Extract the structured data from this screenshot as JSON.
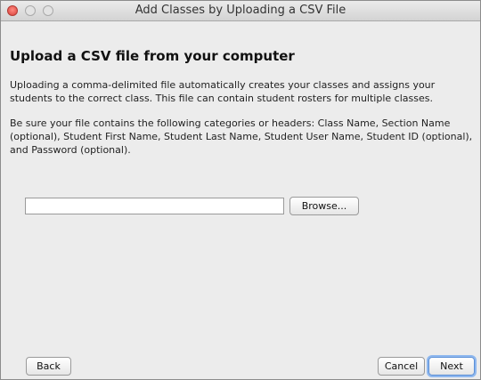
{
  "window": {
    "title": "Add Classes by Uploading a CSV File"
  },
  "content": {
    "heading": "Upload a CSV file from your computer",
    "paragraph1": "Uploading a comma-delimited file automatically creates your classes and assigns your students to the correct class. This file can contain student rosters for multiple classes.",
    "paragraph2": "Be sure your file contains the following categories or headers: Class Name, Section Name (optional), Student First Name, Student Last Name, Student User Name, Student ID (optional), and Password (optional)."
  },
  "file_picker": {
    "value": "",
    "browse_label": "Browse..."
  },
  "footer": {
    "back_label": "Back",
    "cancel_label": "Cancel",
    "next_label": "Next"
  },
  "colors": {
    "close_button": "#d9403a",
    "default_button_ring": "#8fb8ef"
  },
  "icons": [
    "close-icon",
    "minimize-icon",
    "zoom-icon"
  ]
}
